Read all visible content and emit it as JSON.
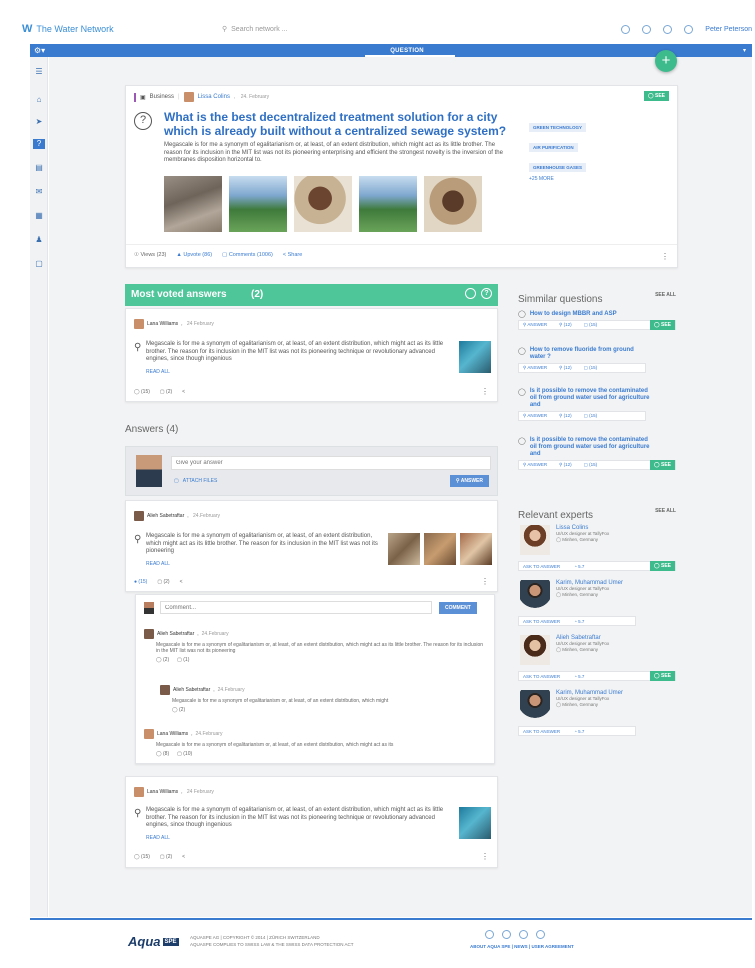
{
  "header": {
    "logo": "W",
    "brand": "The Water Network",
    "search_placeholder": "Search network ...",
    "user": "Peter Peterson"
  },
  "navbar": {
    "tab": "QUESTION"
  },
  "question": {
    "category": "Business",
    "author": "Lissa Colins",
    "date": "24. February",
    "badge": "SEE",
    "title": "What is the best decentralized treatment solution for a city which is already built without a centralized sewage system?",
    "description": "Megascale is for me a synonym of egalitarianism or, at least, of an extent distribution, which might act as its little brother. The reason for its inclusion in the MIT list was not its pioneering enterprising and efficient the strongest novelty is the inversion of the membranes disposition horizontal to.",
    "tags": [
      "GREEN TECHNOLOGY",
      "AIR PURIFICATION",
      "GREENHOUSE GASES"
    ],
    "more": "+25 MORE",
    "stats": {
      "views": "Views (23)",
      "upvotes": "Upvote (86)",
      "comments": "Comments (1006)",
      "share": "Share"
    }
  },
  "most_voted": {
    "title": "Most voted answers",
    "count": "(2)",
    "answer": {
      "author": "Lana Williams",
      "date": "24 February",
      "text": "Megascale is for me a synonym of egalitarianism or, at least, of an extent distribution, which might act as its little brother. The reason for its inclusion in the MIT list was not its pioneering technique or revolutionary advanced engines, since though ingenious",
      "read_all": "READ ALL",
      "votes": "(15)",
      "comments": "(2)"
    }
  },
  "answers": {
    "title": "Answers (4)",
    "placeholder": "Give your answer",
    "attach": "ATTACH FILES",
    "answer_btn": "ANSWER",
    "first": {
      "author": "Alieh Sabetraftar",
      "date": "24.February",
      "text": "Megascale is for me a synonym of egalitarianism or, at least, of an extent distribution, which might act as its little brother. The reason for its inclusion in the MIT list was not its pioneering",
      "read_all": "READ ALL",
      "votes": "(15)",
      "comments": "(2)"
    },
    "comment_placeholder": "Comment...",
    "comment_btn": "COMMENT",
    "comments": [
      {
        "author": "Alieh Sabetraftar",
        "date": "24.February",
        "text": "Megascale is for me a synonym of egalitarianism or, at least, of an extent distribution, which might act as its little brother. The reason for its inclusion in the MIT list was not its pioneering",
        "votes": "(2)",
        "replies": "(1)"
      },
      {
        "author": "Alieh Sabetraftar",
        "date": "24.February",
        "text": "Megascale is for me a synonym of egalitarianism or, at least, of an extent distribution, which might",
        "votes": "(2)"
      },
      {
        "author": "Lana Williams",
        "date": "24.February",
        "text": "Megascale is for me a synonym of egalitarianism or, at least, of an extent distribution, which might act as its",
        "votes": "(8)",
        "replies": "(10)"
      }
    ],
    "second": {
      "author": "Lana Williams",
      "date": "24 February",
      "text": "Megascale is for me a synonym of egalitarianism or, at least, of an extent distribution, which might act as its little brother. The reason for its inclusion in the MIT list was not its pioneering technique or revolutionary advanced engines, since though ingenious",
      "read_all": "READ ALL",
      "votes": "(15)",
      "comments": "(2)"
    }
  },
  "similar": {
    "title": "Simmilar questions",
    "see_all": "SEE ALL",
    "answer_label": "ANSWER",
    "items": [
      {
        "title": "How to design MBBR and ASP",
        "a": "(12)",
        "b": "(15)",
        "see": "SEE"
      },
      {
        "title": "How to remove fluoride from ground water ?",
        "a": "(12)",
        "b": "(15)"
      },
      {
        "title": "Is it possible to remove the contaminated oil from ground water used for agriculture and",
        "a": "(12)",
        "b": "(15)"
      },
      {
        "title": "Is it possible to remove the contaminated oil from ground water used for agriculture and",
        "a": "(12)",
        "b": "(15)",
        "see": "SEE"
      }
    ]
  },
  "experts": {
    "title": "Relevant experts",
    "see_all": "SEE ALL",
    "ask": "ASK TO ANSWER",
    "items": [
      {
        "name": "Lissa Colins",
        "role": "UI/UX designer at TallyFox",
        "loc": "Minhen, Germany",
        "score": "5.7",
        "see": "SEE"
      },
      {
        "name": "Karim, Muhammad Umer",
        "role": "UI/UX designer at TallyFox",
        "loc": "Minhen, Germany",
        "score": "5.7"
      },
      {
        "name": "Alieh Sabetraftar",
        "role": "UI/UX designer at TallyFox",
        "loc": "Minhen, Germany",
        "score": "5.7",
        "see": "SEE"
      },
      {
        "name": "Karim, Muhammad Umer",
        "role": "UI/UX designer at TallyFox",
        "loc": "Minhen, Germany",
        "score": "5.7"
      }
    ]
  },
  "footer": {
    "logo": "Aqua",
    "logo_badge": "SPE",
    "line1": "AQUASPE AG | COPYRIGHT © 2014 | ZÜRICH SWITZERLAND",
    "line2": "AQUASPE COMPLIES TO SWISS LAW & THE SWISS DATA PROTECTION ACT",
    "links": "ABOUT AQUA SPE | NEWS | USER AGREEMENT"
  }
}
